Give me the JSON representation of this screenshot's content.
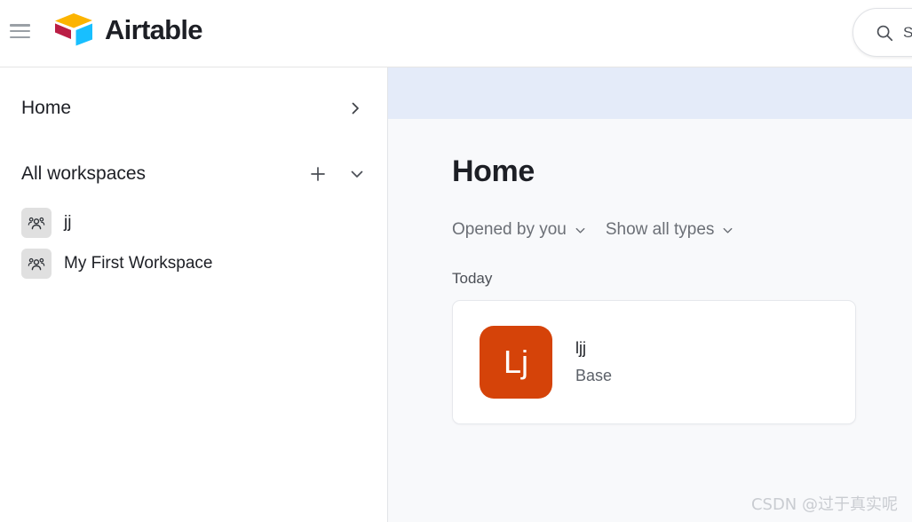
{
  "header": {
    "menu_icon": "hamburger-icon",
    "brand": "Airtable",
    "logo_icon": "airtable-logo-icon",
    "search": {
      "icon": "search-icon",
      "value": "S",
      "placeholder": "Search..."
    }
  },
  "sidebar": {
    "home": {
      "label": "Home",
      "expand_icon": "chevron-right-icon"
    },
    "section": {
      "label": "All workspaces",
      "add_icon": "plus-icon",
      "collapse_icon": "chevron-down-icon"
    },
    "workspaces": [
      {
        "label": "jj",
        "icon": "users-group-icon"
      },
      {
        "label": "My First Workspace",
        "icon": "users-group-icon"
      }
    ]
  },
  "main": {
    "title": "Home",
    "filters": [
      {
        "label": "Opened by you",
        "icon": "chevron-down-icon"
      },
      {
        "label": "Show all types",
        "icon": "chevron-down-icon"
      }
    ],
    "group_label": "Today",
    "bases": [
      {
        "initials": "Lj",
        "name": "ljj",
        "type": "Base",
        "color": "#d54309"
      }
    ]
  },
  "watermark": "CSDN @过于真实呢",
  "colors": {
    "banner": "#e4ebf9",
    "main_bg": "#f8f9fb",
    "base_accent": "#d54309",
    "logo_yellow": "#fcb400",
    "logo_red": "#ba1e45",
    "logo_cyan": "#18bfff",
    "logo_blue": "#2d7ff9"
  }
}
